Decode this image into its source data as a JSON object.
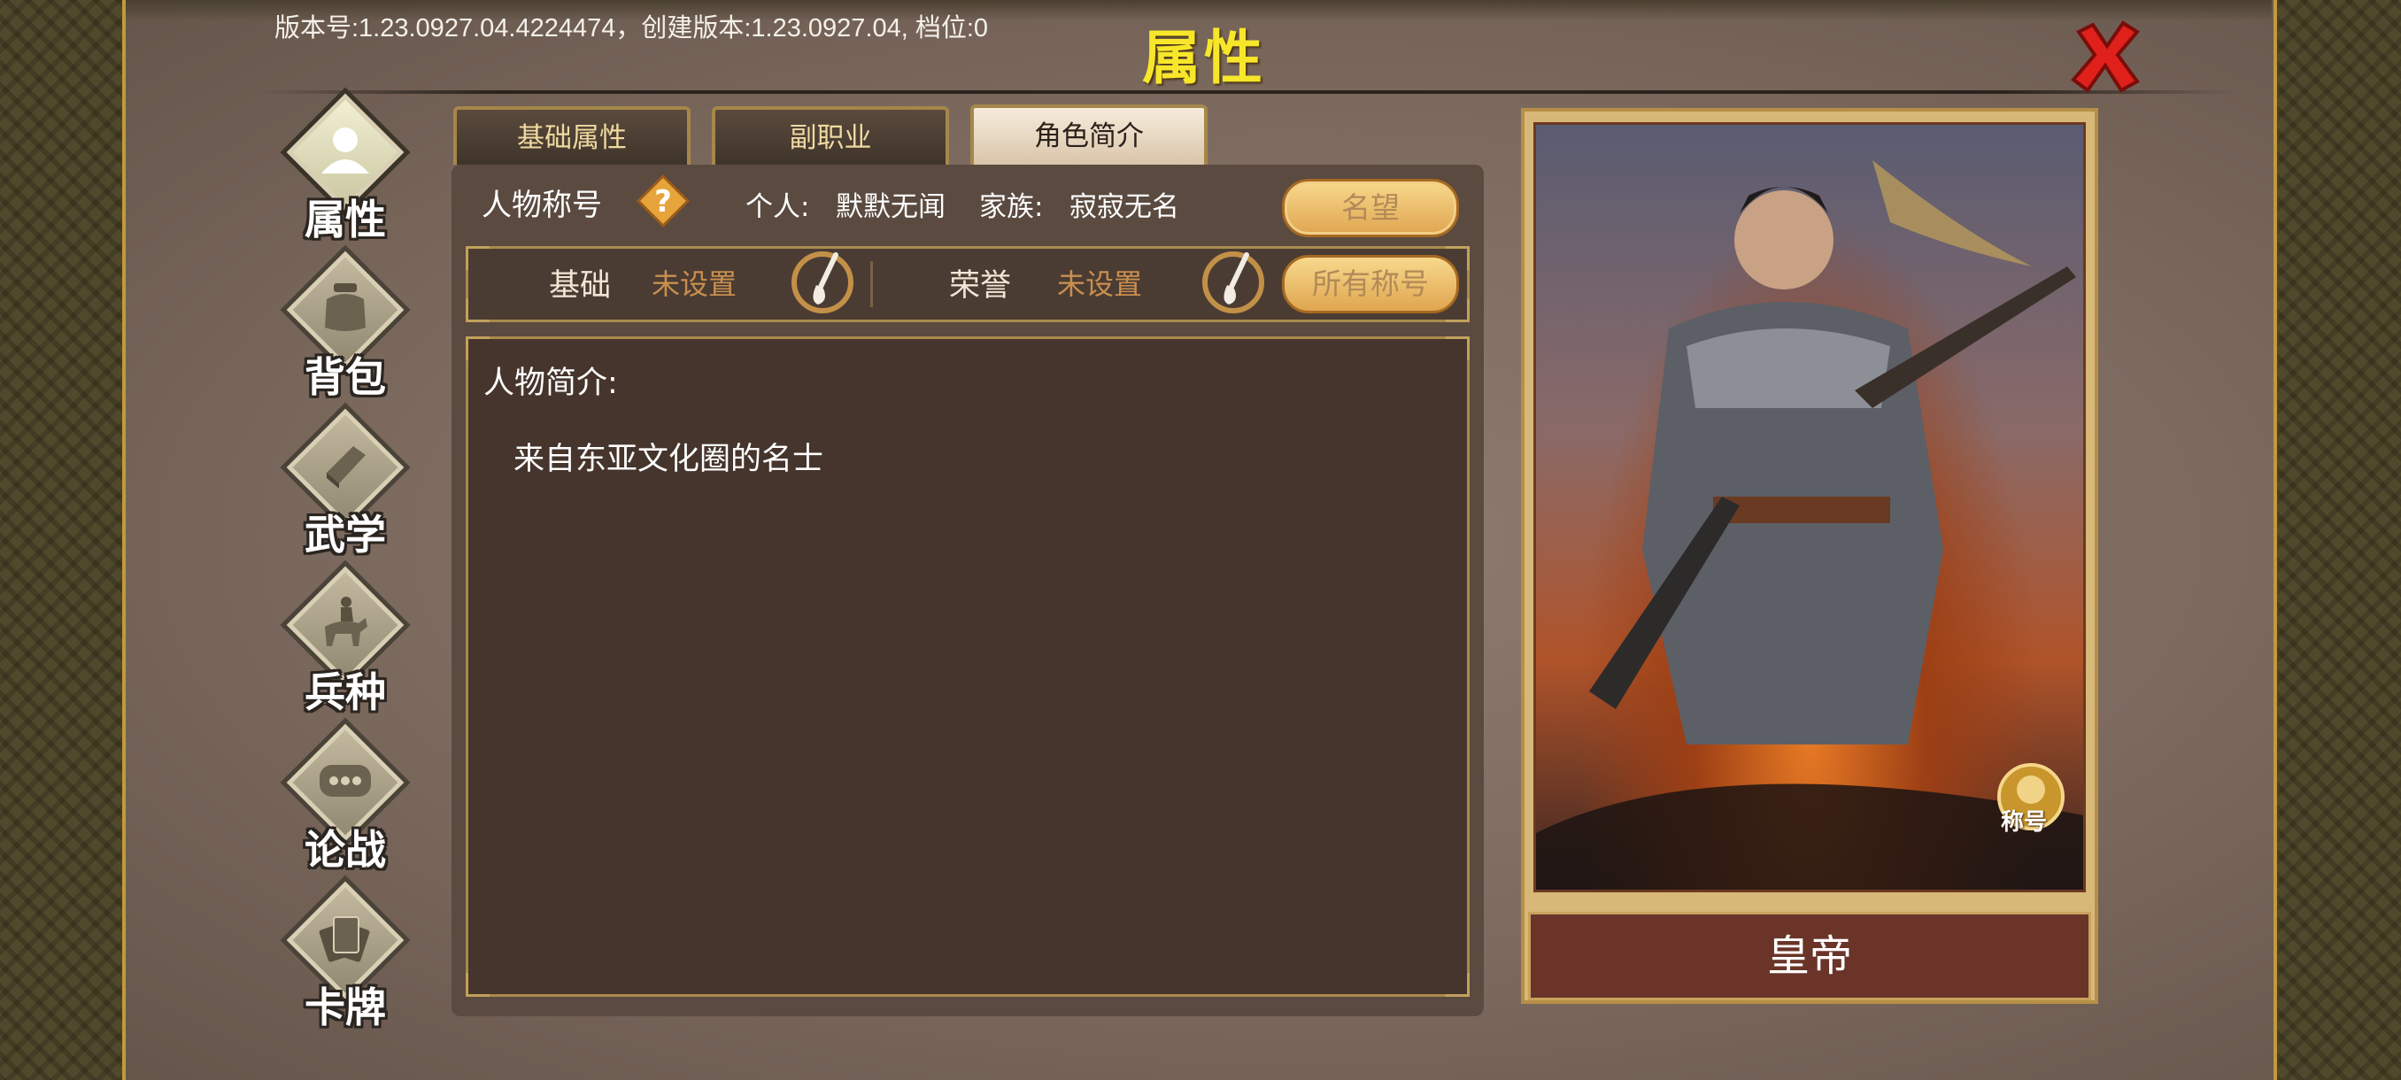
{
  "version_text": "版本号:1.23.0927.04.4224474，创建版本:1.23.0927.04, 档位:0",
  "page_title": "属性",
  "nav": {
    "items": [
      {
        "label": "属性",
        "active": true
      },
      {
        "label": "背包",
        "active": false
      },
      {
        "label": "武学",
        "active": false
      },
      {
        "label": "兵种",
        "active": false
      },
      {
        "label": "论战",
        "active": false
      },
      {
        "label": "卡牌",
        "active": false
      }
    ]
  },
  "tabs": [
    {
      "label": "基础属性",
      "active": false
    },
    {
      "label": "副职业",
      "active": false
    },
    {
      "label": "角色简介",
      "active": true
    }
  ],
  "profile": {
    "title_label": "人物称号",
    "personal_label": "个人:",
    "personal_value": "默默无闻",
    "family_label": "家族:",
    "family_value": "寂寂无名",
    "fame_button": "名望",
    "basic_label": "基础",
    "basic_value": "未设置",
    "honor_label": "荣誉",
    "honor_value": "未设置",
    "all_titles_button": "所有称号",
    "desc_heading": "人物简介:",
    "desc_text": "来自东亚文化圈的名士"
  },
  "portrait": {
    "name": "皇帝",
    "badge_text": "称号"
  },
  "colors": {
    "title_yellow": "#f7e62a",
    "close_red": "#e0201a",
    "value_orange": "#c98f4f",
    "name_plate": "#6a3428"
  }
}
